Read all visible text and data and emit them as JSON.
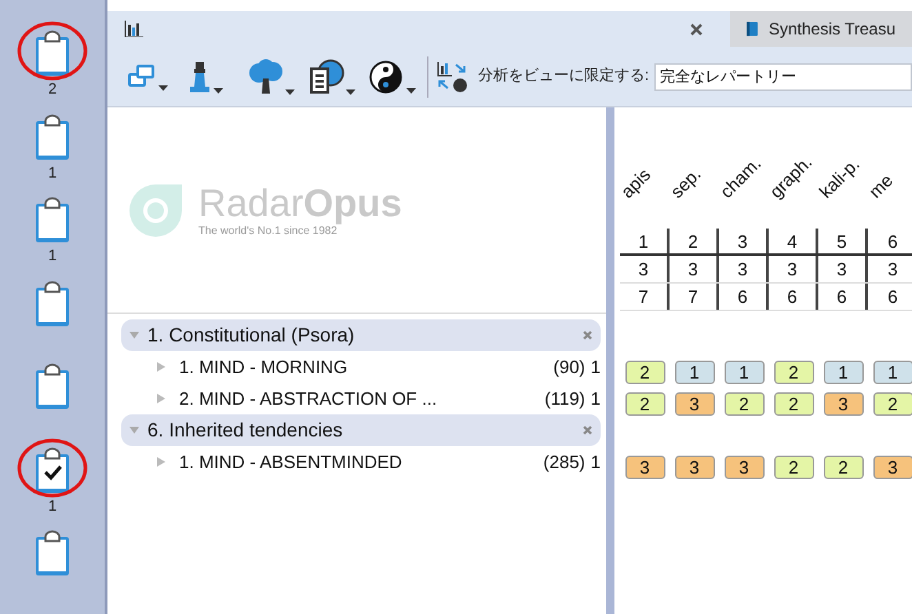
{
  "sidebar": {
    "items": [
      {
        "checked": false,
        "count": "2",
        "highlighted": true
      },
      {
        "checked": false,
        "count": "1",
        "highlighted": false
      },
      {
        "checked": false,
        "count": "1",
        "highlighted": false
      },
      {
        "checked": false,
        "highlighted": false
      },
      {
        "checked": false,
        "highlighted": false
      },
      {
        "checked": true,
        "count": "1",
        "highlighted": true
      },
      {
        "checked": false,
        "highlighted": false
      }
    ]
  },
  "tabs": [
    {
      "selected": true,
      "closable": true
    },
    {
      "label": "Synthesis Treasu",
      "selected": false,
      "closable": false
    }
  ],
  "toolbar": {
    "filter_label": "分析をビューに限定する:",
    "filter_value": "完全なレパートリー"
  },
  "logo": {
    "name": "Radar**Opus**",
    "tagline": "The world's No.1 since 1982"
  },
  "remedies": [
    {
      "name": "apis",
      "cells": [
        "1",
        "3",
        "7"
      ]
    },
    {
      "name": "sep.",
      "cells": [
        "2",
        "3",
        "7"
      ]
    },
    {
      "name": "cham.",
      "cells": [
        "3",
        "3",
        "6"
      ]
    },
    {
      "name": "graph.",
      "cells": [
        "4",
        "3",
        "6"
      ]
    },
    {
      "name": "kali-p.",
      "cells": [
        "5",
        "3",
        "6"
      ]
    },
    {
      "name": "me",
      "cells": [
        "6",
        "3",
        "6"
      ]
    }
  ],
  "groups": [
    {
      "title": "1. Constitutional (Psora)",
      "expanded": true,
      "rubrics": [
        {
          "label": "1. MIND - MORNING",
          "count": "(90)",
          "weight": "1",
          "grades": [
            {
              "value": "2",
              "color": "#e4f5a6"
            },
            {
              "value": "1",
              "color": "#cfe1ea"
            },
            {
              "value": "1",
              "color": "#cfe1ea"
            },
            {
              "value": "2",
              "color": "#e4f5a6"
            },
            {
              "value": "1",
              "color": "#cfe1ea"
            },
            {
              "value": "1",
              "color": "#cfe1ea"
            }
          ]
        },
        {
          "label": "2. MIND - ABSTRACTION OF ...",
          "count": "(119)",
          "weight": "1",
          "grades": [
            {
              "value": "2",
              "color": "#e4f5a6"
            },
            {
              "value": "3",
              "color": "#f6c27c"
            },
            {
              "value": "2",
              "color": "#e4f5a6"
            },
            {
              "value": "2",
              "color": "#e4f5a6"
            },
            {
              "value": "3",
              "color": "#f6c27c"
            },
            {
              "value": "2",
              "color": "#e4f5a6"
            }
          ]
        }
      ]
    },
    {
      "title": "6. Inherited tendencies",
      "expanded": true,
      "rubrics": [
        {
          "label": "1. MIND - ABSENTMINDED",
          "count": "(285)",
          "weight": "1",
          "grades": [
            {
              "value": "3",
              "color": "#f6c27c"
            },
            {
              "value": "3",
              "color": "#f6c27c"
            },
            {
              "value": "3",
              "color": "#f6c27c"
            },
            {
              "value": "2",
              "color": "#e4f5a6"
            },
            {
              "value": "2",
              "color": "#e4f5a6"
            },
            {
              "value": "3",
              "color": "#f6c27c"
            }
          ]
        }
      ]
    }
  ]
}
